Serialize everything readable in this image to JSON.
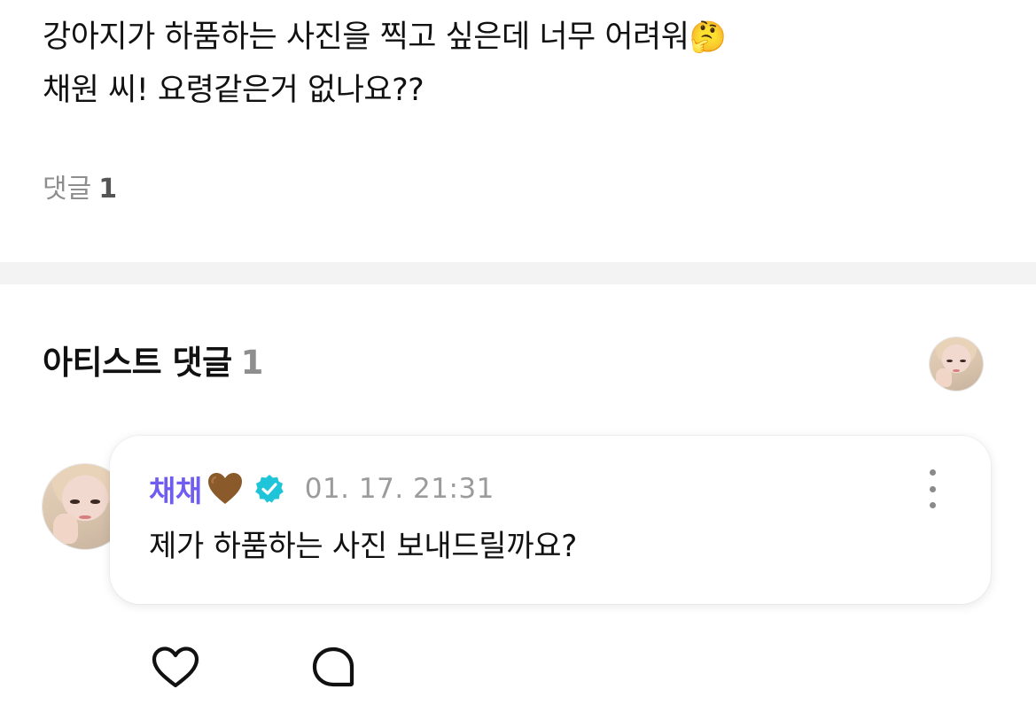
{
  "post": {
    "line1": "강아지가 하품하는 사진을 찍고 싶은데 너무 어려워",
    "line1_emoji": "🤔",
    "line2": "채원 씨! 요령같은거 없나요??",
    "comment_label": "댓글",
    "comment_count": "1"
  },
  "artist_comments": {
    "title": "아티스트 댓글",
    "count": "1"
  },
  "comment": {
    "author": "채채",
    "author_emoji": "heart-brown-icon",
    "timestamp": "01. 17. 21:31",
    "text": "제가 하품하는 사진 보내드릴까요?"
  },
  "actions": {
    "like_icon": "heart-outline-icon",
    "reply_icon": "speech-bubble-icon"
  },
  "colors": {
    "author": "#6f5cf0",
    "verified": "#1fc4d8",
    "muted": "#8e8e8e",
    "divider": "#f3f3f3"
  }
}
